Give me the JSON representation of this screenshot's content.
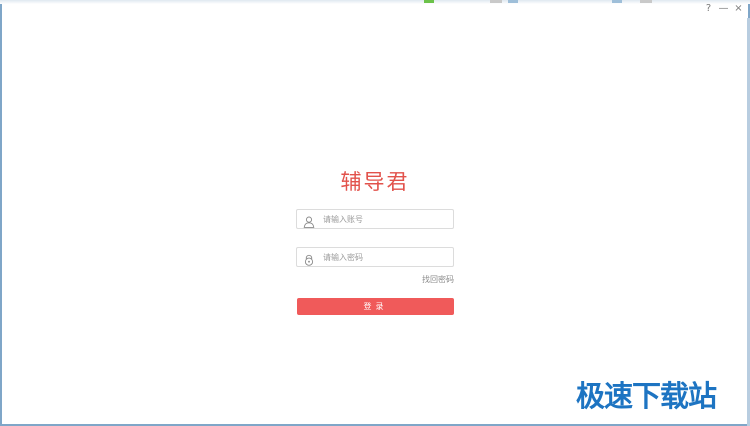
{
  "window": {
    "help_label": "?",
    "minimize_label": "—",
    "close_label": "×"
  },
  "app": {
    "title": "辅导君"
  },
  "login": {
    "account_placeholder": "请输入账号",
    "password_placeholder": "请输入密码",
    "forgot_password": "找回密码",
    "submit_label": "登录"
  },
  "watermark": {
    "text": "极速下载站"
  },
  "icons": {
    "account": "user-icon",
    "password": "lock-icon"
  },
  "colors": {
    "brand": "#e2524b",
    "button": "#f05a5a",
    "window_border": "#7fa6c8",
    "watermark": "#1d74c2"
  }
}
